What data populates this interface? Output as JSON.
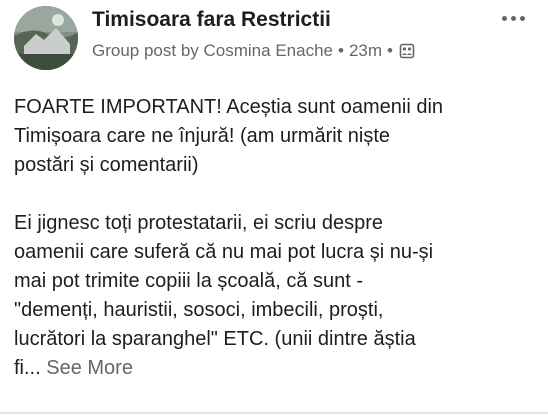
{
  "post": {
    "group_name": "Timisoara fara Restrictii",
    "meta_prefix": "Group post by",
    "author": "Cosmina Enache",
    "separator": "•",
    "time": "23m",
    "privacy_icon": "group-audience-icon",
    "more_icon": "more-options-icon",
    "avatar_icon": "group-avatar-landscape"
  },
  "body": {
    "p1": [
      "FOARTE IMPORTANT! Aceștia sunt oamenii din",
      "Timișoara care ne înjură! (am urmărit niște",
      "postări și comentarii)"
    ],
    "p2": [
      "Ei jignesc toți protestatarii, ei scriu despre",
      "oamenii care suferă că nu mai pot lucra și nu-și",
      "mai pot trimite copiii la școală, că sunt -",
      "\"demenți, hauristii, sosoci, imbecili, proști,",
      "lucrători la sparanghel\" ETC. (unii dintre ăștia",
      "fi..."
    ],
    "see_more": "See More"
  },
  "colors": {
    "text": "#1c1e21",
    "secondary": "#65676b",
    "divider": "#e4e6eb"
  }
}
